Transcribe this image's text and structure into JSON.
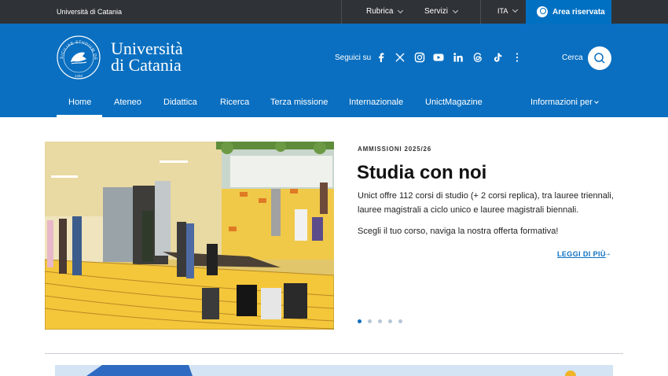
{
  "topbar": {
    "university": "Università di Catania",
    "rubrica": "Rubrica",
    "servizi": "Servizi",
    "lang": "ITA",
    "area_riservata": "Area riservata"
  },
  "header": {
    "logo_line1": "Università",
    "logo_line2": "di Catania",
    "seal_text": "SICILIAE STVDIVM GENERALE",
    "seal_year": "1434",
    "seguici": "Seguici su",
    "social_icons": [
      "facebook-icon",
      "x-icon",
      "instagram-icon",
      "youtube-icon",
      "linkedin-icon",
      "threads-icon",
      "tiktok-icon",
      "more-icon"
    ],
    "cerca": "Cerca"
  },
  "nav": {
    "items": [
      "Home",
      "Ateneo",
      "Didattica",
      "Ricerca",
      "Terza missione",
      "Internazionale",
      "UnictMagazine"
    ],
    "info_per": "Informazioni per"
  },
  "hero": {
    "kicker": "AMMISSIONI 2025/26",
    "title": "Studia con noi",
    "description": "Unict offre 112 corsi di studio (+ 2 corsi replica), tra lauree triennali, lauree magistrali a ciclo unico e lauree magistrali biennali.",
    "description2": "Scegli il tuo corso, naviga la nostra offerta formativa!",
    "cta": "LEGGI DI PIÙ",
    "slide_count": 5,
    "active_slide": 1
  },
  "colors": {
    "topbar_bg": "#2f3337",
    "brand_blue": "#0a6fc0",
    "area_blue": "#0070c2"
  }
}
